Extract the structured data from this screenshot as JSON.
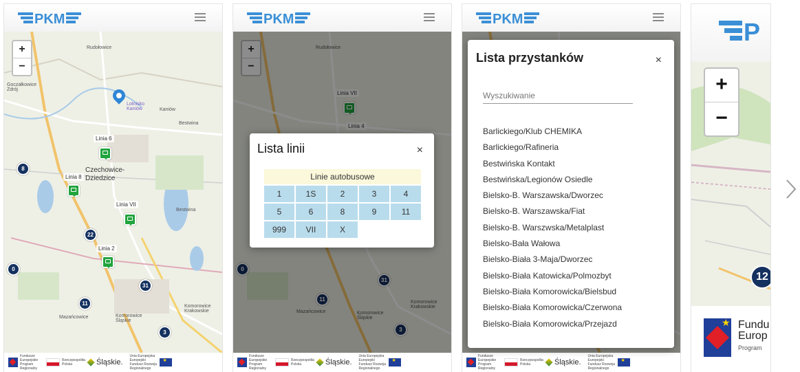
{
  "app": {
    "logo": "PKM"
  },
  "zoom": {
    "plus": "+",
    "minus": "−"
  },
  "footer": {
    "fe_text": "Fundusze Europejskie Program Regionalny",
    "rp_text": "Rzeczpospolita Polska",
    "slaskie": "Śląskie.",
    "ue_text": "Unia Europejska Europejski Fundusz Rozwoju Regionalnego"
  },
  "map": {
    "places": {
      "rudolowice": "Rudołowice",
      "goczalkowice": "Goczałkowice Zdrój",
      "lotnisko": "Lotnisko Kaniów",
      "kaniow": "Kaniów",
      "czechowice": "Czechowice-Dziedzice",
      "bestwina": "Bestwina",
      "mazancowice": "Mazańcowice",
      "komorowice_slaskie": "Komorowice Śląskie",
      "komorowice_krakowskie": "Komorowice Krakowskie"
    },
    "line_labels": [
      "Linia 6",
      "Linia 8",
      "Linia VII",
      "Linia 2"
    ],
    "line_labels_p2": [
      "Linia VII",
      "Linia 4"
    ],
    "stops": [
      "8",
      "22",
      "0",
      "31",
      "11",
      "3"
    ]
  },
  "lines_modal": {
    "title": "Lista linii",
    "close": "×",
    "section": "Linie autobusowe",
    "lines": [
      "1",
      "1S",
      "2",
      "3",
      "4",
      "5",
      "6",
      "8",
      "9",
      "11",
      "999",
      "VII",
      "X"
    ]
  },
  "stops_modal": {
    "title": "Lista przystanków",
    "close": "×",
    "search_placeholder": "Wyszukiwanie",
    "stops": [
      "Barlickiego/Klub CHEMIKA",
      "Barlickiego/Rafineria",
      "Bestwińska Kontakt",
      "Bestwińska/Legionów Osiedle",
      "Bielsko-B. Warszawska/Dworzec",
      "Bielsko-B. Warszawska/Fiat",
      "Bielsko-B. Warszwska/Metalplast",
      "Bielsko-Bała Wałowa",
      "Bielsko-Biała 3-Maja/Dworzec",
      "Bielsko-Biała Katowicka/Polmozbyt",
      "Bielsko-Biała Komorowicka/Bielsbud",
      "Bielsko-Biała Komorowicka/Czerwona",
      "Bielsko-Biała Komorowicka/Przejazd"
    ]
  },
  "zoomed": {
    "stop": "12",
    "footer_text": "Fundu Europ",
    "footer_small": "Program"
  }
}
